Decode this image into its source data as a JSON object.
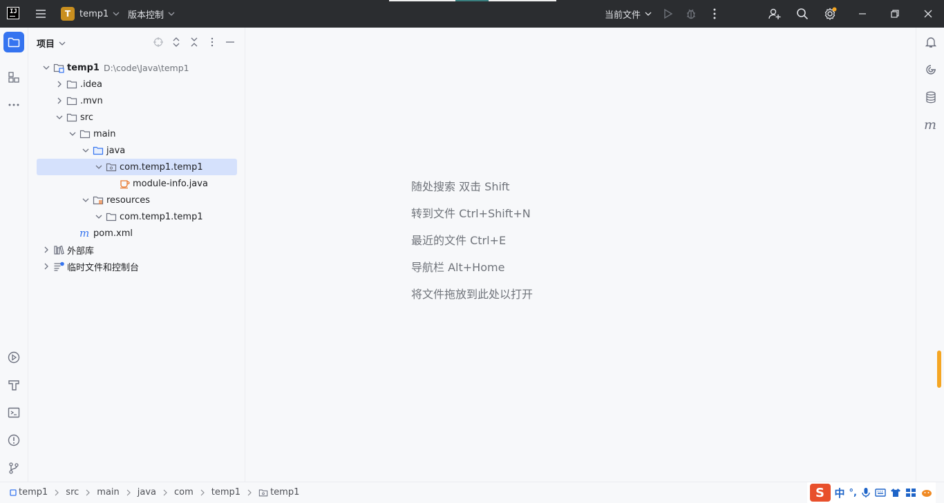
{
  "titlebar": {
    "project_badge": "T",
    "project_name": "temp1",
    "vcs_label": "版本控制",
    "run_config": "当前文件"
  },
  "project_panel": {
    "title": "项目",
    "tree": [
      {
        "label": "temp1",
        "path": "D:\\code\\Java\\temp1",
        "level": 0,
        "expanded": true,
        "icon": "module-folder-icon",
        "bold": true
      },
      {
        "label": ".idea",
        "level": 1,
        "expanded": false,
        "icon": "folder-icon"
      },
      {
        "label": ".mvn",
        "level": 1,
        "expanded": false,
        "icon": "folder-icon"
      },
      {
        "label": "src",
        "level": 1,
        "expanded": true,
        "icon": "folder-icon"
      },
      {
        "label": "main",
        "level": 2,
        "expanded": true,
        "icon": "folder-icon"
      },
      {
        "label": "java",
        "level": 3,
        "expanded": true,
        "icon": "source-folder-icon"
      },
      {
        "label": "com.temp1.temp1",
        "level": 4,
        "expanded": true,
        "icon": "package-icon",
        "selected": true
      },
      {
        "label": "module-info.java",
        "level": 5,
        "icon": "java-file-icon"
      },
      {
        "label": "resources",
        "level": 3,
        "expanded": true,
        "icon": "resources-folder-icon"
      },
      {
        "label": "com.temp1.temp1",
        "level": 4,
        "expanded": true,
        "icon": "folder-icon"
      },
      {
        "label": "pom.xml",
        "level": 2,
        "icon": "maven-icon"
      },
      {
        "label": "外部库",
        "level": 0,
        "expanded": false,
        "icon": "library-icon"
      },
      {
        "label": "临时文件和控制台",
        "level": 0,
        "expanded": false,
        "icon": "scratches-icon"
      }
    ]
  },
  "editor": {
    "hints": [
      "随处搜索 双击 Shift",
      "转到文件 Ctrl+Shift+N",
      "最近的文件 Ctrl+E",
      "导航栏 Alt+Home",
      "将文件拖放到此处以打开"
    ]
  },
  "statusbar": {
    "breadcrumbs": [
      "temp1",
      "src",
      "main",
      "java",
      "com",
      "temp1",
      "temp1"
    ]
  },
  "ime": {
    "logo": "S",
    "mode": "中",
    "punct": "°,"
  },
  "colors": {
    "titlebar_bg": "#2b2d30",
    "accent": "#3574f0",
    "selection": "#d5e1fc",
    "project_badge": "#c98f1f"
  }
}
